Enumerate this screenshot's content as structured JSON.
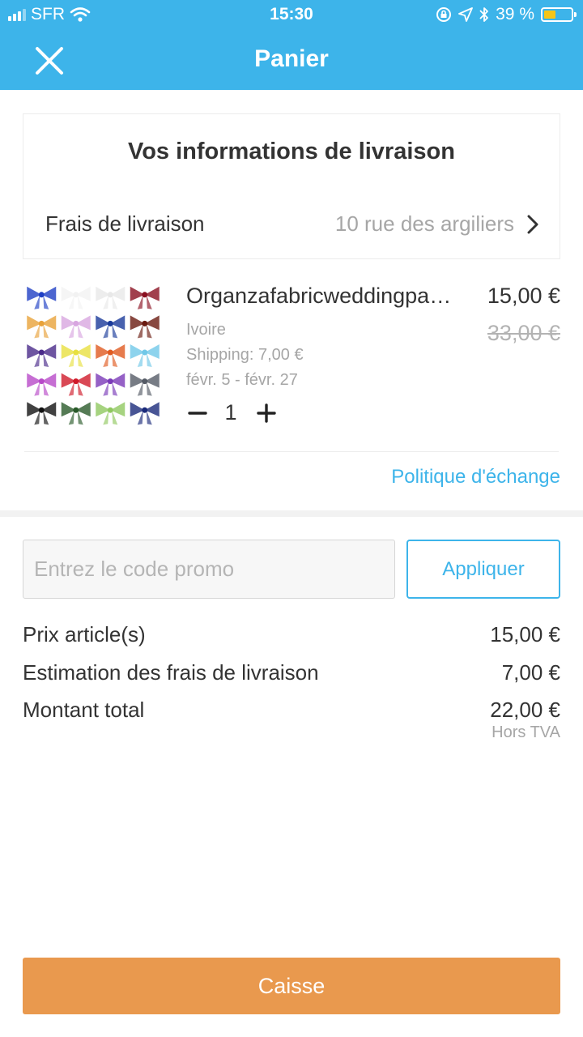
{
  "status_bar": {
    "carrier": "SFR",
    "time": "15:30",
    "battery_percent": "39 %",
    "battery_level": 0.39,
    "icons": [
      "signal-icon",
      "wifi-icon",
      "rotation-lock-icon",
      "location-arrow-icon",
      "bluetooth-icon",
      "battery-icon"
    ]
  },
  "header": {
    "title": "Panier",
    "close_icon": "close-icon",
    "background": "#3db4ea"
  },
  "delivery": {
    "title": "Vos informations de livraison",
    "label": "Frais de livraison",
    "address": "10 rue des argiliers",
    "chevron_icon": "chevron-right-icon"
  },
  "product": {
    "name": "Organzafabricweddingpa…",
    "price": "15,00 €",
    "original_price": "33,00 €",
    "variant": "Ivoire",
    "shipping": "Shipping:  7,00 €",
    "dates": "févr. 5 - févr. 27",
    "quantity": "1",
    "swatch_colors": [
      [
        "#1f3fc4",
        "#f2f2f2",
        "#e8e8e8",
        "#8a1020"
      ],
      [
        "#e8a23a",
        "#d8a6e0",
        "#1a3a9a",
        "#6a1a10"
      ],
      [
        "#4a2a8a",
        "#e8e040",
        "#e05a20",
        "#70c8e8"
      ],
      [
        "#b84ac8",
        "#d01a2a",
        "#7a3ab8",
        "#555b66"
      ],
      [
        "#111111",
        "#2a5a2a",
        "#90c860",
        "#1a2a7a"
      ]
    ]
  },
  "exchange_policy": "Politique d'échange",
  "promo": {
    "placeholder": "Entrez le code promo",
    "value": "",
    "apply_label": "Appliquer"
  },
  "summary": {
    "items_label": "Prix article(s)",
    "items_value": "15,00 €",
    "shipping_label": "Estimation des frais de livraison",
    "shipping_value": "7,00 €",
    "total_label": "Montant total",
    "total_value": "22,00 €",
    "tax_note": "Hors TVA"
  },
  "checkout": {
    "label": "Caisse",
    "color": "#e9994e"
  },
  "colors": {
    "accent": "#3db4ea",
    "checkout": "#e9994e",
    "muted_text": "#a6a6a6"
  }
}
